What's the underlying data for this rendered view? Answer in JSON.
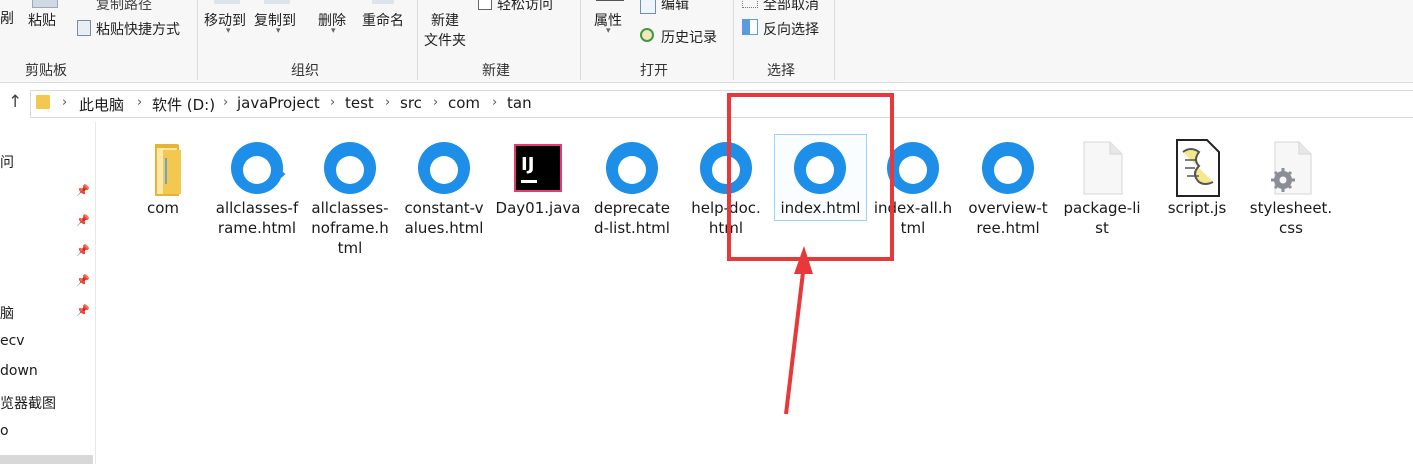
{
  "ribbon": {
    "clipboard": {
      "cut_fragment": "剐",
      "copy_path": "复制路径",
      "paste": "粘贴",
      "paste_shortcut": "粘贴快捷方式",
      "label": "剪贴板"
    },
    "organize": {
      "move_to": "移动到",
      "copy_to": "复制到",
      "delete": "删除",
      "rename": "重命名",
      "label": "组织"
    },
    "new": {
      "new_folder_line1": "新建",
      "new_folder_line2": "文件夹",
      "easy_access": "轻松访问",
      "label": "新建"
    },
    "open": {
      "properties": "属性",
      "edit": "编辑",
      "history": "历史记录",
      "label": "打开"
    },
    "select": {
      "select_none": "全部取消",
      "invert": "反向选择",
      "label": "选择"
    }
  },
  "address": {
    "crumbs": [
      "此电脑",
      "软件 (D:)",
      "javaProject",
      "test",
      "src",
      "com",
      "tan"
    ]
  },
  "nav": {
    "items": [
      "问",
      "",
      "",
      "",
      "",
      "脑",
      "ecv",
      "down",
      "览器截图",
      "o"
    ]
  },
  "files": [
    {
      "name": "com",
      "icon": "folder-icon"
    },
    {
      "name": "allclasses-frame.html",
      "icon": "browser-html-icon"
    },
    {
      "name": "allclasses-noframe.html",
      "icon": "browser-html-icon"
    },
    {
      "name": "constant-values.html",
      "icon": "browser-html-icon"
    },
    {
      "name": "Day01.java",
      "icon": "intellij-icon"
    },
    {
      "name": "deprecated-list.html",
      "icon": "browser-html-icon"
    },
    {
      "name": "help-doc.html",
      "icon": "browser-html-icon"
    },
    {
      "name": "index.html",
      "icon": "browser-html-icon"
    },
    {
      "name": "index-all.html",
      "icon": "browser-html-icon"
    },
    {
      "name": "overview-tree.html",
      "icon": "browser-html-icon"
    },
    {
      "name": "package-list",
      "icon": "blank-file-icon"
    },
    {
      "name": "script.js",
      "icon": "script-file-icon"
    },
    {
      "name": "stylesheet.css",
      "icon": "css-file-icon"
    }
  ],
  "file_labels": {
    "f0": "com",
    "f1": "allclasses-f\nrame.html",
    "f2": "allclasses-\nnoframe.h\ntml",
    "f3": "constant-v\nalues.html",
    "f4": "Day01.java",
    "f5": "deprecate\nd-list.html",
    "f6": "help-doc.\nhtml",
    "f7": "index.html",
    "f8": "index-all.h\ntml",
    "f9": "overview-t\nree.html",
    "f10": "package-li\nst",
    "f11": "script.js",
    "f12": "stylesheet.\ncss"
  },
  "colors": {
    "annotation": "#e8383a",
    "selection_border": "#99d1ff",
    "browser_blue": "#1e8fe8",
    "folder": "#f3c84e"
  }
}
